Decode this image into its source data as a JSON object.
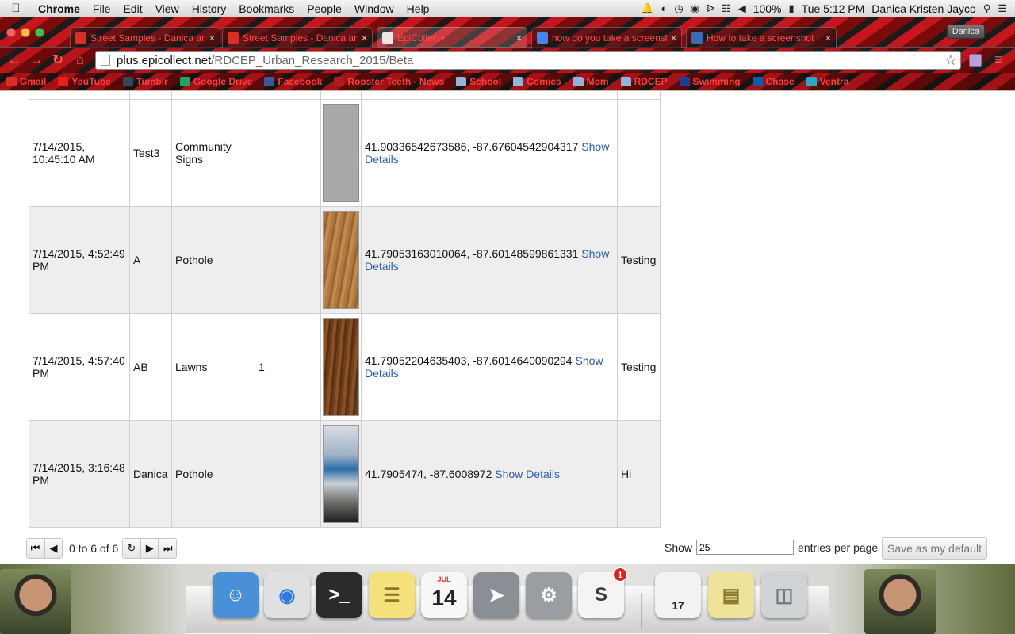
{
  "menubar": {
    "app": "Chrome",
    "items": [
      "File",
      "Edit",
      "View",
      "History",
      "Bookmarks",
      "People",
      "Window",
      "Help"
    ],
    "battery": "100%",
    "clock": "Tue 5:12 PM",
    "user": "Danica Kristen Jayco"
  },
  "tabs": [
    {
      "label": "Street Samples - Danica and",
      "icon": "map-pin-icon",
      "color": "#d93025"
    },
    {
      "label": "Street Samples - Danica and",
      "icon": "map-pin-icon",
      "color": "#d93025"
    },
    {
      "label": "EpiCollect+",
      "icon": "page-icon",
      "color": "#e8e8e8"
    },
    {
      "label": "how do you take a screenshot",
      "icon": "google-icon",
      "color": "#4285f4"
    },
    {
      "label": "How to take a screenshot",
      "icon": "monitor-icon",
      "color": "#3b6bb5"
    }
  ],
  "profile_button": "Danica",
  "address": {
    "host": "plus.epicollect.net",
    "path": "/RDCEP_Urban_Research_2015/Beta"
  },
  "bookmarks": [
    {
      "label": "Gmail",
      "icon": "gmail-icon",
      "color": "#d93025"
    },
    {
      "label": "YouTube",
      "icon": "youtube-icon",
      "color": "#e62117"
    },
    {
      "label": "Tumblr",
      "icon": "tumblr-icon",
      "color": "#35465c"
    },
    {
      "label": "Google Drive",
      "icon": "drive-icon",
      "color": "#1fa463"
    },
    {
      "label": "Facebook",
      "icon": "facebook-icon",
      "color": "#3b5998"
    },
    {
      "label": "Rooster Teeth - News",
      "icon": "roosterteeth-icon",
      "color": "#b01c1c"
    },
    {
      "label": "School",
      "icon": "folder-icon",
      "color": "#8fb3d9"
    },
    {
      "label": "Comics",
      "icon": "folder-icon",
      "color": "#8fb3d9"
    },
    {
      "label": "Mom",
      "icon": "folder-icon",
      "color": "#8fb3d9"
    },
    {
      "label": "RDCEP",
      "icon": "folder-icon",
      "color": "#8fb3d9"
    },
    {
      "label": "Swimming",
      "icon": "swimming-icon",
      "color": "#1c3f94"
    },
    {
      "label": "Chase",
      "icon": "chase-icon",
      "color": "#0f5ba7"
    },
    {
      "label": "Ventra",
      "icon": "ventra-icon",
      "color": "#27a9c6"
    }
  ],
  "table": {
    "link_text": "Show Details",
    "rows": [
      {
        "date": "7/14/2015, 10:45:10 AM",
        "name": "Test3",
        "category": "Community Signs",
        "qty": "",
        "image": "gray",
        "location": "41.90336542673586, -87.67604542904317",
        "note": ""
      },
      {
        "date": "7/14/2015, 4:52:49 PM",
        "name": "A",
        "category": "Pothole",
        "qty": "",
        "image": "wood1",
        "location": "41.79053163010064, -87.60148599861331",
        "note": "Testing"
      },
      {
        "date": "7/14/2015, 4:57:40 PM",
        "name": "AB",
        "category": "Lawns",
        "qty": "1",
        "image": "wood2",
        "location": "41.79052204635403, -87.6014640090294",
        "note": "Testing"
      },
      {
        "date": "7/14/2015, 3:16:48 PM",
        "name": "Danica",
        "category": "Pothole",
        "qty": "",
        "image": "photo",
        "location": "41.7905474, -87.6008972",
        "note": "Hi"
      }
    ]
  },
  "pager": {
    "info": "0 to 6 of 6",
    "show_label": "Show",
    "per_page_value": "25",
    "per_page_suffix": "entries per page",
    "save_default": "Save as my default"
  },
  "dock": [
    {
      "name": "finder-icon",
      "color": "#4a90d9"
    },
    {
      "name": "chrome-icon",
      "color": "#e0e0e0"
    },
    {
      "name": "terminal-icon",
      "color": "#2b2b2b"
    },
    {
      "name": "notes-icon",
      "color": "#f5e27a"
    },
    {
      "name": "calendar-icon",
      "color": "#f7f7f7",
      "month": "JUL",
      "day": "14"
    },
    {
      "name": "launchpad-icon",
      "color": "#8a8f96"
    },
    {
      "name": "system-preferences-icon",
      "color": "#9a9ea3"
    },
    {
      "name": "slack-icon",
      "color": "#f4f4f4",
      "badge": "1"
    },
    {
      "name": "calendar-window-icon",
      "color": "#f2f2f2",
      "day": "17"
    },
    {
      "name": "stickies-window-icon",
      "color": "#efe29a"
    },
    {
      "name": "trash-icon",
      "color": "#cfd3d6"
    }
  ]
}
